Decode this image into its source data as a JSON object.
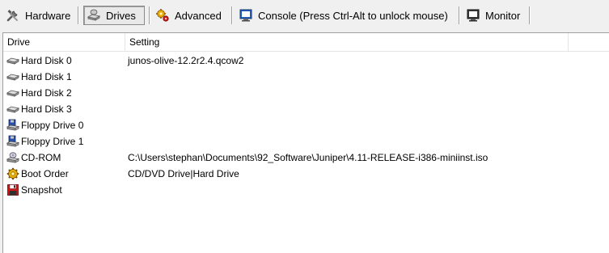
{
  "toolbar": {
    "buttons": [
      {
        "label": "Hardware",
        "icon": "tools-icon",
        "active": false
      },
      {
        "label": "Drives",
        "icon": "drives-icon",
        "active": true
      },
      {
        "label": "Advanced",
        "icon": "gears-icon",
        "active": false
      },
      {
        "label": "Console (Press Ctrl-Alt to unlock mouse)",
        "icon": "console-icon",
        "active": false
      },
      {
        "label": "Monitor",
        "icon": "monitor-icon",
        "active": false
      }
    ]
  },
  "table": {
    "columns": [
      "Drive",
      "Setting"
    ],
    "rows": [
      {
        "drive": "Hard Disk 0",
        "setting": "junos-olive-12.2r2.4.qcow2",
        "icon": "hard-disk-icon"
      },
      {
        "drive": "Hard Disk 1",
        "setting": "",
        "icon": "hard-disk-icon"
      },
      {
        "drive": "Hard Disk 2",
        "setting": "",
        "icon": "hard-disk-icon"
      },
      {
        "drive": "Hard Disk 3",
        "setting": "",
        "icon": "hard-disk-icon"
      },
      {
        "drive": "Floppy Drive 0",
        "setting": "",
        "icon": "floppy-drive-icon"
      },
      {
        "drive": "Floppy Drive 1",
        "setting": "",
        "icon": "floppy-drive-icon"
      },
      {
        "drive": "CD-ROM",
        "setting": "C:\\Users\\stephan\\Documents\\92_Software\\Juniper\\4.11-RELEASE-i386-miniinst.iso",
        "icon": "cd-rom-icon"
      },
      {
        "drive": "Boot Order",
        "setting": "CD/DVD Drive|Hard Drive",
        "icon": "boot-order-icon"
      },
      {
        "drive": "Snapshot",
        "setting": "",
        "icon": "snapshot-icon"
      }
    ]
  },
  "colors": {
    "window_bg": "#f0f0f0",
    "list_bg": "#ffffff",
    "snapshot_red": "#d01818",
    "floppy_blue": "#2a4fa8",
    "boot_gold": "#e8b000"
  }
}
